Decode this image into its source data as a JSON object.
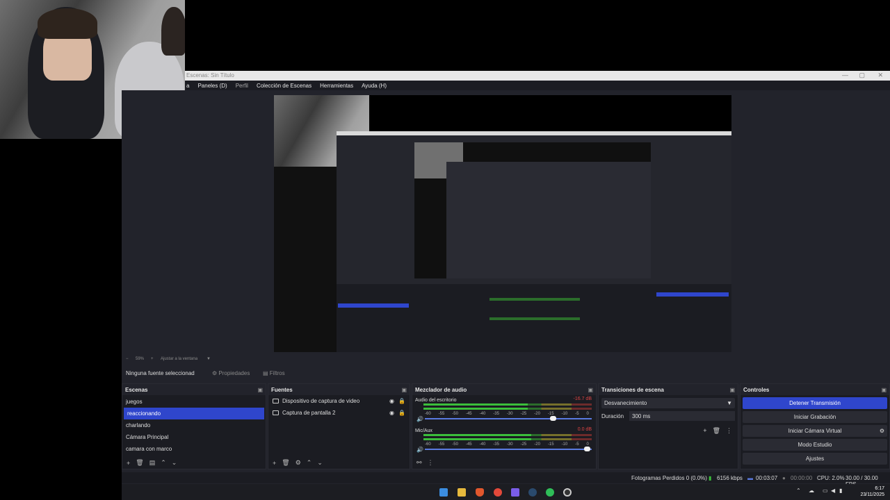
{
  "window": {
    "title": "Escenas: Sin Título"
  },
  "menu": {
    "items": [
      "a",
      "Paneles (D)",
      "Perfil",
      "Colección de Escenas",
      "Herramientas",
      "Ayuda (H)"
    ]
  },
  "preview": {
    "zoom": "59%",
    "fit_label": "Ajustar a la ventana"
  },
  "source_toolbar": {
    "no_source": "Ninguna fuente seleccionad",
    "properties": "Propiedades",
    "filters": "Filtros"
  },
  "scenes": {
    "title": "Escenas",
    "items": [
      "juegos",
      "reaccionando",
      "charlando",
      "Cámara Principal",
      "camara con marco"
    ],
    "active_index": 1
  },
  "sources": {
    "title": "Fuentes",
    "items": [
      "Dispositivo de captura de video",
      "Captura de pantalla 2"
    ]
  },
  "mixer": {
    "title": "Mezclador de audio",
    "tracks": [
      {
        "name": "Audio del escritorio",
        "db": "-16.7 dB",
        "level": 0.62,
        "volume": 0.78
      },
      {
        "name": "Mic/Aux",
        "db": "0.0 dB",
        "level": 0.64,
        "volume": 0.99
      }
    ],
    "scale": [
      "-60",
      "-55",
      "-50",
      "-45",
      "-40",
      "-35",
      "-30",
      "-25",
      "-20",
      "-15",
      "-10",
      "-5",
      "0"
    ]
  },
  "transitions": {
    "title": "Transiciones de escena",
    "selected": "Desvanecimiento",
    "duration_label": "Duración",
    "duration_value": "300 ms"
  },
  "controls": {
    "title": "Controles",
    "buttons": [
      "Detener Transmisión",
      "Iniciar Grabación",
      "Iniciar Cámara Virtual",
      "Modo Estudio",
      "Ajustes"
    ]
  },
  "status": {
    "dropped": "Fotogramas Perdidos 0 (0.0%)",
    "bitrate": "6156 kbps",
    "stream_time": "00:03:07",
    "rec_time": "00:00:00",
    "cpu": "CPU: 2.0%",
    "fps": "30.00 / 30.00 FPS"
  },
  "clock": {
    "time": "6:17",
    "date": "23/11/2025"
  },
  "colors": {
    "accent": "#2f46cc",
    "bg": "#1b1c22",
    "meter_green": "#3bbf3b"
  }
}
